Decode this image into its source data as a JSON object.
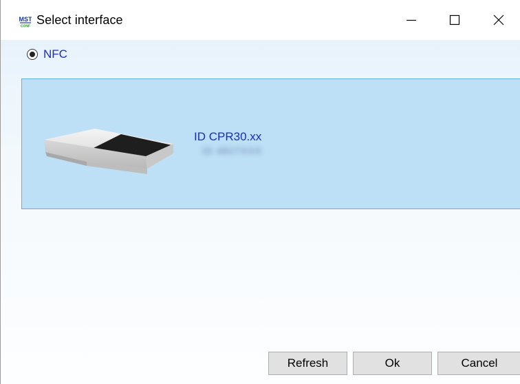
{
  "window": {
    "title": "Select interface",
    "icon": "mst-app-icon"
  },
  "controls": {
    "minimize_icon": "minimize-icon",
    "maximize_icon": "maximize-icon",
    "close_icon": "close-icon"
  },
  "interface_option": {
    "label": "NFC",
    "selected": true
  },
  "device": {
    "name": "ID CPR30.xx",
    "serial": "ID 4827XXX"
  },
  "buttons": {
    "refresh": "Refresh",
    "ok": "Ok",
    "cancel": "Cancel"
  },
  "colors": {
    "link_text": "#1c2db8",
    "selection_fill": "#bde0f6",
    "selection_border": "#5fb2e0"
  }
}
